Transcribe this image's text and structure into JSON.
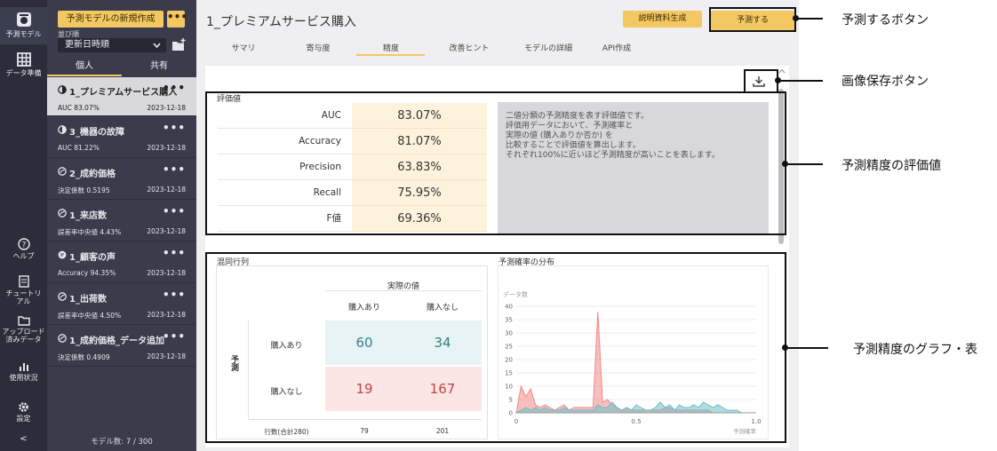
{
  "rail": {
    "items": [
      {
        "label": "予測モデル",
        "icon": "model-icon"
      },
      {
        "label": "データ準備",
        "icon": "table-icon"
      },
      {
        "label": "ヘルプ",
        "icon": "help-icon"
      },
      {
        "label": "チュートリ\nアル",
        "icon": "book-icon"
      },
      {
        "label": "アップロード\n済みデータ",
        "icon": "folder-icon"
      },
      {
        "label": "使用状況",
        "icon": "bar-chart-icon"
      },
      {
        "label": "設定",
        "icon": "gear-icon"
      }
    ],
    "collapse": "<"
  },
  "panel": {
    "new_button": "予測モデルの新規作成",
    "menu_button": "•••",
    "sort_label": "並び順",
    "sort_value": "更新日時順",
    "tabs": [
      "個人",
      "共有"
    ],
    "models": [
      {
        "name": "1_プレミアムサービス購入",
        "metric": "AUC 83.07%",
        "date": "2023-12-18"
      },
      {
        "name": "3_機器の故障",
        "metric": "AUC 81.22%",
        "date": "2023-12-18"
      },
      {
        "name": "2_成約価格",
        "metric": "決定係数 0.5195",
        "date": "2023-12-18"
      },
      {
        "name": "1_来店数",
        "metric": "誤差率中央値 4.43%",
        "date": "2023-12-18"
      },
      {
        "name": "1_顧客の声",
        "metric": "Accuracy 94.35%",
        "date": "2023-12-18"
      },
      {
        "name": "1_出荷数",
        "metric": "誤差率中央値 4.50%",
        "date": "2023-12-18"
      },
      {
        "name": "1_成約価格_データ追加",
        "metric": "決定係数 0.4909",
        "date": "2023-12-18"
      }
    ],
    "dots": "•••",
    "model_count": "モデル数: 7 / 300"
  },
  "main": {
    "title": "1_プレミアムサービス購入",
    "explain_button": "説明資料生成",
    "predict_button": "予測する",
    "tabs": [
      "サマリ",
      "寄与度",
      "精度",
      "改善ヒント",
      "モデルの詳細",
      "API作成"
    ],
    "eval": {
      "title": "評価値",
      "rows": [
        {
          "label": "AUC",
          "value": "83.07%"
        },
        {
          "label": "Accuracy",
          "value": "81.07%"
        },
        {
          "label": "Precision",
          "value": "63.83%"
        },
        {
          "label": "Recall",
          "value": "75.95%"
        },
        {
          "label": "F値",
          "value": "69.36%"
        }
      ],
      "description": [
        "二値分類の予測精度を表す評価値です。",
        "評価用データにおいて、予測確率と",
        "実際の値 (購入ありか否か) を",
        "比較することで評価値を算出します。",
        "それぞれ100%に近いほど予測精度が高いことを表します。"
      ]
    },
    "confusion": {
      "title": "混同行列",
      "actual_header": "実際の値",
      "predicted_header": "予測",
      "col_labels": [
        "購入あり",
        "購入なし"
      ],
      "row_labels": [
        "購入あり",
        "購入なし"
      ],
      "cells": [
        [
          "60",
          "34"
        ],
        [
          "19",
          "167"
        ]
      ],
      "total_label": "行数(合計280)",
      "col_totals": [
        "79",
        "201"
      ]
    },
    "histogram": {
      "title": "予測確率の分布"
    }
  },
  "chart_data": {
    "type": "area",
    "title": "予測確率の分布",
    "xlabel": "予測確率",
    "ylabel": "データ数",
    "xlim": [
      0,
      1.0
    ],
    "ylim": [
      0,
      40
    ],
    "x_ticks": [
      "0",
      "0.5",
      "1.0"
    ],
    "y_ticks": [
      "0",
      "5",
      "10",
      "15",
      "20",
      "25",
      "30",
      "35",
      "40"
    ],
    "x": [
      0.0,
      0.02,
      0.04,
      0.06,
      0.08,
      0.1,
      0.12,
      0.14,
      0.16,
      0.18,
      0.2,
      0.22,
      0.24,
      0.26,
      0.28,
      0.3,
      0.32,
      0.34,
      0.36,
      0.38,
      0.4,
      0.42,
      0.44,
      0.46,
      0.48,
      0.5,
      0.52,
      0.54,
      0.56,
      0.58,
      0.6,
      0.62,
      0.64,
      0.66,
      0.68,
      0.7,
      0.72,
      0.74,
      0.76,
      0.78,
      0.8,
      0.82,
      0.84,
      0.86,
      0.88,
      0.9,
      0.92,
      0.94,
      0.96,
      0.98,
      1.0
    ],
    "series": [
      {
        "values": [
          0,
          10,
          6,
          9,
          3,
          2,
          3,
          2,
          1,
          2,
          3,
          1,
          2,
          2,
          2,
          2,
          2,
          38,
          4,
          5,
          3,
          2,
          1,
          2,
          1,
          1,
          1,
          1,
          1,
          1,
          1,
          2,
          2,
          1,
          1,
          1,
          1,
          1,
          1,
          1,
          1,
          0,
          0,
          0,
          0,
          0,
          0,
          0,
          0,
          0,
          0
        ]
      },
      {
        "values": [
          0,
          1,
          2,
          1,
          2,
          1,
          2,
          1,
          1,
          1,
          2,
          1,
          1,
          1,
          1,
          1,
          1,
          3,
          2,
          2,
          4,
          2,
          1,
          2,
          1,
          3,
          2,
          1,
          1,
          2,
          4,
          2,
          3,
          1,
          3,
          2,
          2,
          3,
          2,
          4,
          3,
          2,
          3,
          2,
          1,
          1,
          1,
          0,
          0,
          0,
          0
        ]
      }
    ],
    "colors": [
      "#f08a8a",
      "#6cbfc7"
    ]
  },
  "annotations": [
    {
      "label": "予測するボタン"
    },
    {
      "label": "画像保存ボタン"
    },
    {
      "label": "予測精度の評価値"
    },
    {
      "label": "予測精度のグラフ・表"
    }
  ]
}
